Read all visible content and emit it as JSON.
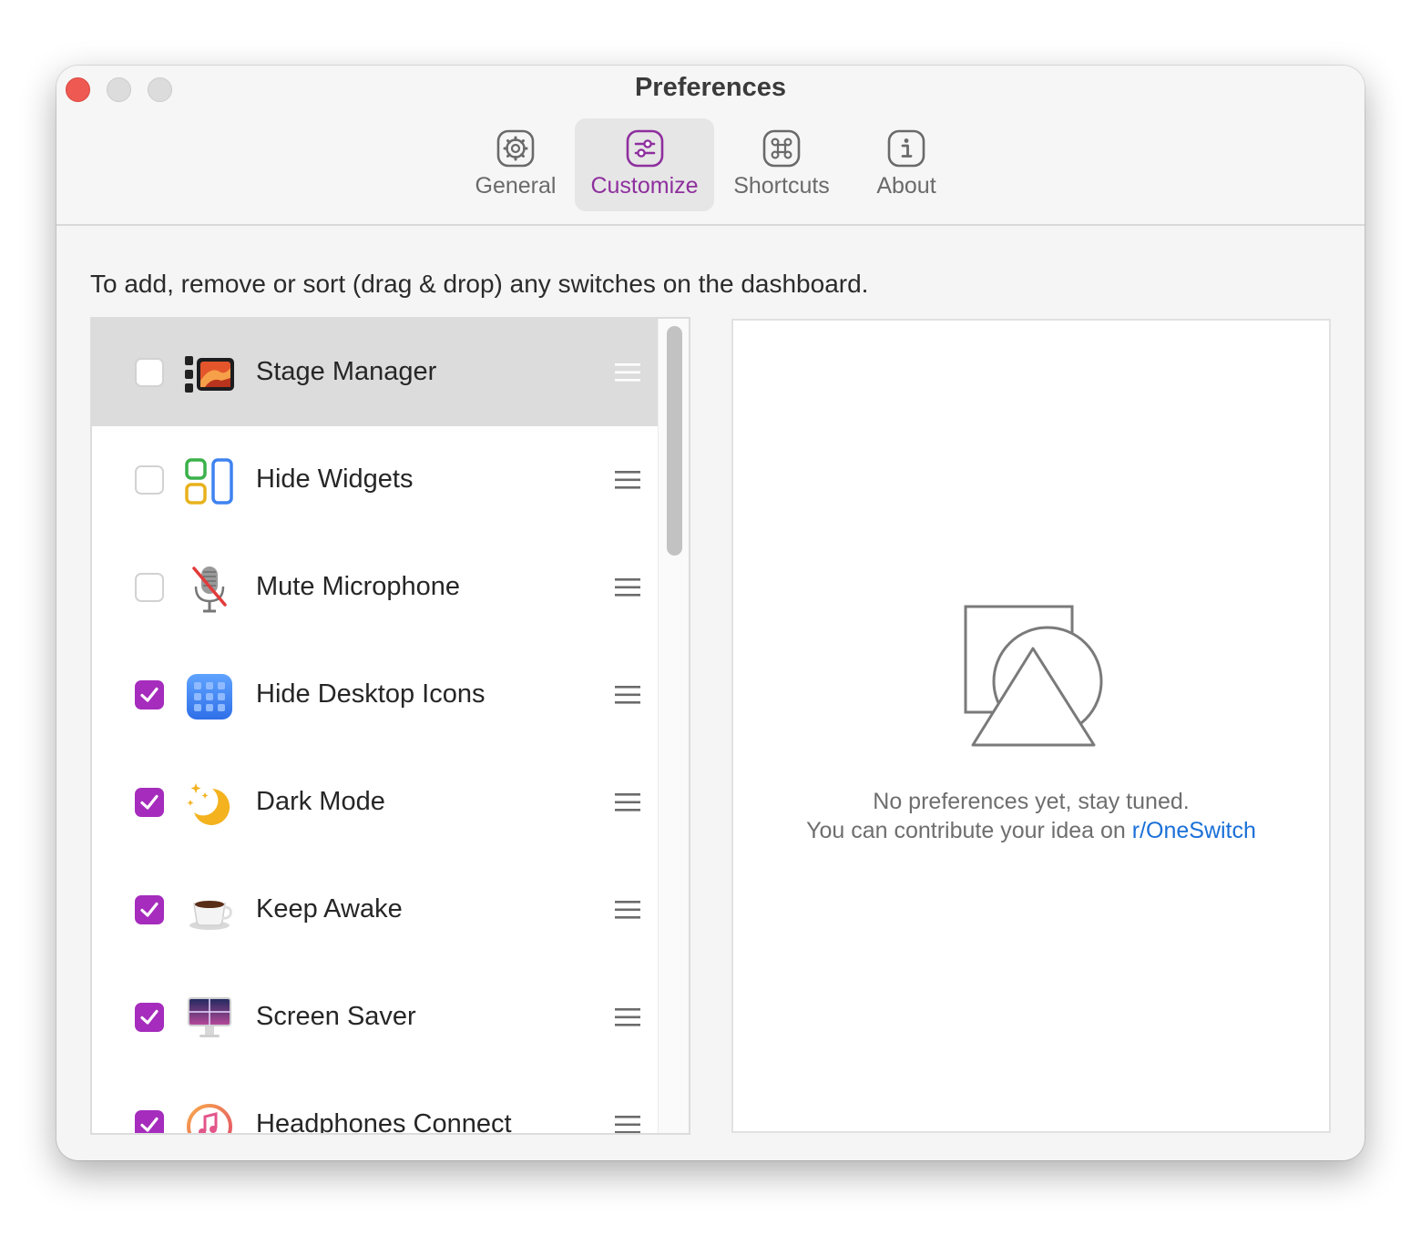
{
  "window": {
    "title": "Preferences"
  },
  "tabs": [
    {
      "id": "general",
      "label": "General",
      "icon": "gear-icon",
      "active": false
    },
    {
      "id": "customize",
      "label": "Customize",
      "icon": "sliders-icon",
      "active": true
    },
    {
      "id": "shortcuts",
      "label": "Shortcuts",
      "icon": "command-icon",
      "active": false
    },
    {
      "id": "about",
      "label": "About",
      "icon": "info-icon",
      "active": false
    }
  ],
  "customize": {
    "description": "To add, remove or sort (drag & drop) any switches on the dashboard.",
    "switches": [
      {
        "label": "Stage Manager",
        "checked": false,
        "selected": true,
        "icon": "stage-manager-icon"
      },
      {
        "label": "Hide Widgets",
        "checked": false,
        "selected": false,
        "icon": "widgets-icon"
      },
      {
        "label": "Mute Microphone",
        "checked": false,
        "selected": false,
        "icon": "microphone-muted-icon"
      },
      {
        "label": "Hide Desktop Icons",
        "checked": true,
        "selected": false,
        "icon": "desktop-grid-icon"
      },
      {
        "label": "Dark Mode",
        "checked": true,
        "selected": false,
        "icon": "moon-icon"
      },
      {
        "label": "Keep Awake",
        "checked": true,
        "selected": false,
        "icon": "coffee-cup-icon"
      },
      {
        "label": "Screen Saver",
        "checked": true,
        "selected": false,
        "icon": "monitor-icon"
      },
      {
        "label": "Headphones Connect",
        "checked": true,
        "selected": false,
        "icon": "headphones-music-icon"
      }
    ],
    "empty_state": {
      "line1": "No preferences yet, stay tuned.",
      "line2_prefix": "You can contribute your idea on ",
      "link_text": "r/OneSwitch"
    }
  },
  "colors": {
    "accent": "#a52cbc",
    "link": "#1a6fd8",
    "close_button": "#ee5a52"
  }
}
